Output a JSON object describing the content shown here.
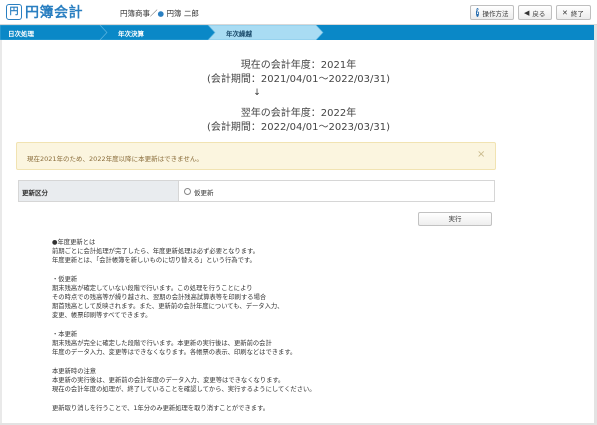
{
  "app": {
    "logo_mark": "円",
    "logo_text": "円簿会計"
  },
  "user": {
    "company": "円簿商事",
    "separator": "／",
    "dot": "●",
    "name": "円簿 二郎"
  },
  "toolbar": {
    "help_label": "操作方法",
    "help_glyph": "?",
    "back_label": "戻る",
    "back_glyph": "◀",
    "close_label": "終了",
    "close_glyph": "✕"
  },
  "nav": {
    "steps": [
      {
        "label": "日次処理"
      },
      {
        "label": "年次決算"
      },
      {
        "label": "年次繰越"
      }
    ],
    "active_index": 2
  },
  "current": {
    "year_line": "現在の会計年度：2021年",
    "period_line": "(会計期間：2021/04/01～2022/03/31)"
  },
  "arrow": "↓",
  "next": {
    "year_line": "翌年の会計年度：2022年",
    "period_line": "(会計期間：2022/04/01～2023/03/31)"
  },
  "alert": {
    "text": "現在2021年のため、2022年度以降に本更新はできません。",
    "close_glyph": "×"
  },
  "update": {
    "label": "更新区分",
    "option": "仮更新"
  },
  "execute_label": "実行",
  "description": [
    "●年度更新とは",
    "前期ごとに会計処理が完了したら、年度更新処理は必ず必要となります。",
    "年度更新とは、「会計帳簿を新しいものに切り替える」という行為です。",
    "",
    "・仮更新",
    "期末残高が確定していない段階で行います。この処理を行うことにより",
    "その時点での残高等が繰り越され、翌期の会計残高試算表等を印刷する場合",
    "期首残高として反映されます。また、更新前の会計年度についても、データ入力、",
    "変更、帳票印刷等すべてできます。",
    "",
    "・本更新",
    "期末残高が完全に確定した段階で行います。本更新の実行後は、更新前の会計",
    "年度のデータ入力、変更等はできなくなります。各帳票の表示、印刷などはできます。",
    "",
    "本更新時の注意",
    "本更新の実行後は、更新前の会計年度のデータ入力、変更等はできなくなります。",
    "現在の会計年度の処理が、終了していることを確認してから、実行するようにしてください。",
    "",
    "更新取り消しを行うことで、1年分のみ更新処理を取り消すことができます。"
  ],
  "colors": {
    "nav_bg": "#0a88c7",
    "nav_active": "#a9dcf3",
    "brand": "#2a7fc1",
    "alert_bg": "#fbf5df",
    "alert_text": "#8a6d3b"
  }
}
